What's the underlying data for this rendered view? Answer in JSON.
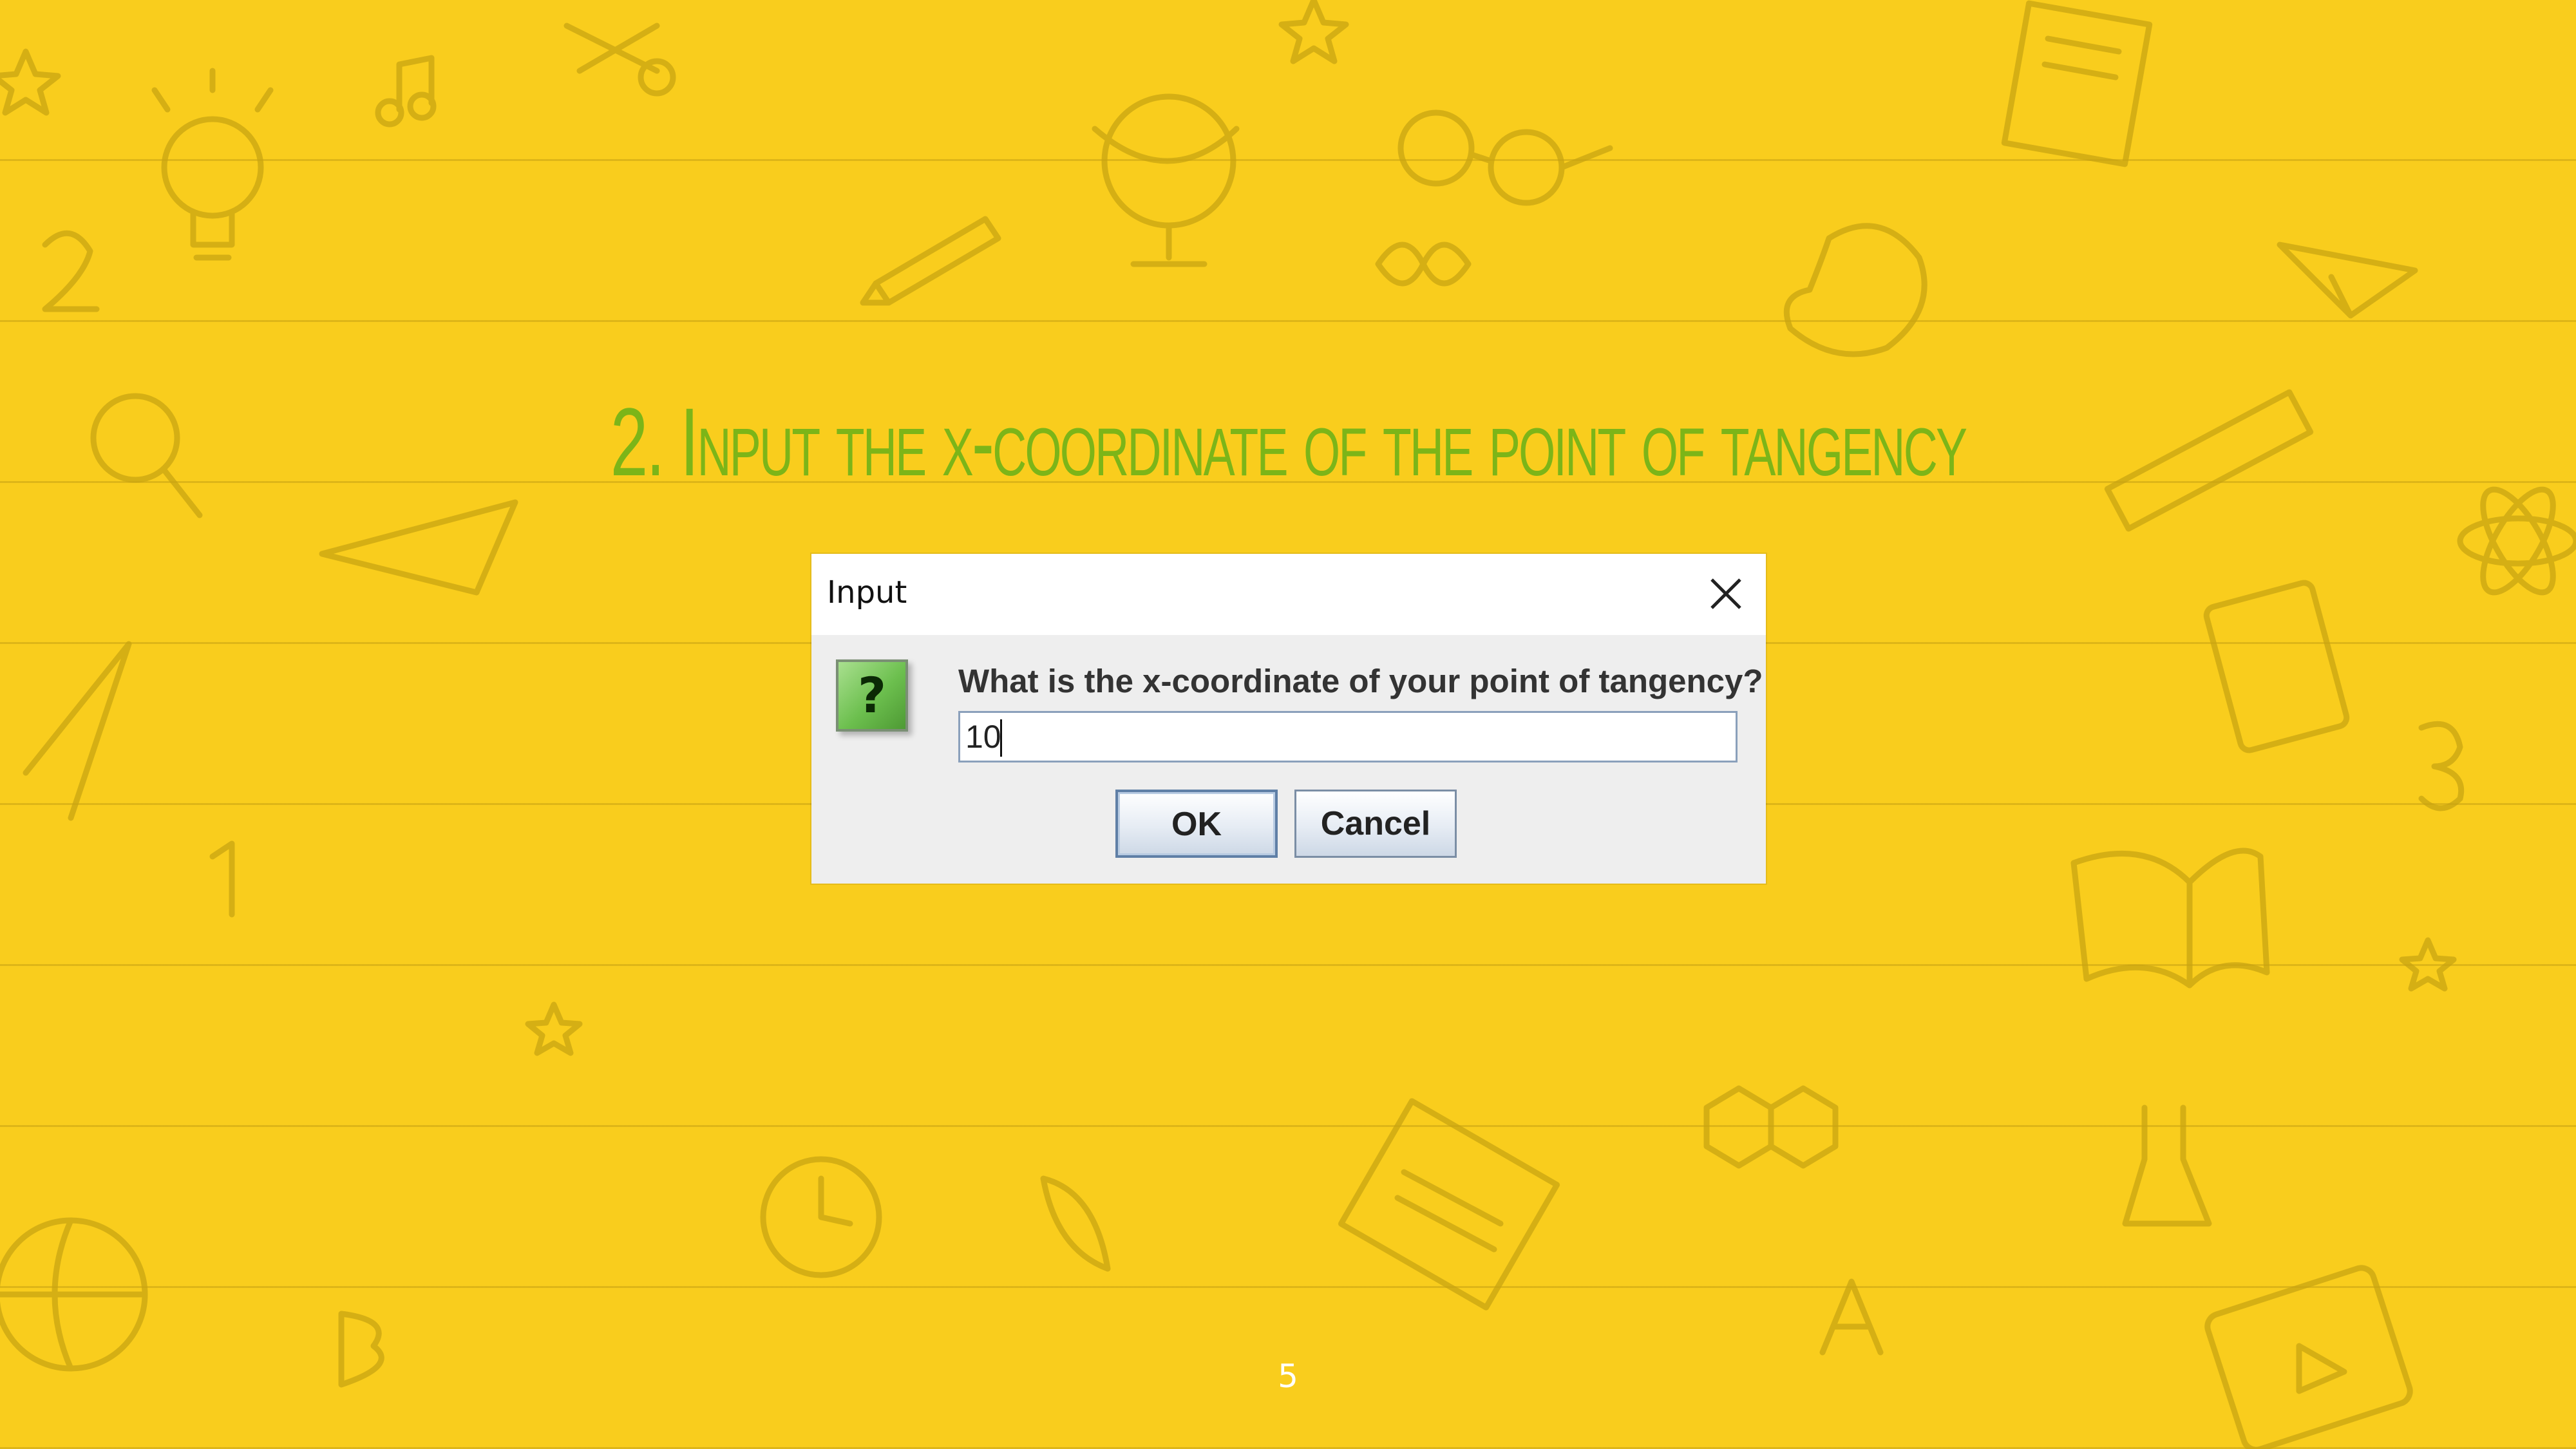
{
  "slide": {
    "title": "2. Input the x-coordinate of the point of tangency",
    "page_number": "5",
    "background_color": "#f9cd1d",
    "title_color": "#7cb518"
  },
  "dialog": {
    "title": "Input",
    "close_icon": "close-icon",
    "question_icon": "question-mark-icon",
    "question_glyph": "?",
    "prompt": "What is the x-coordinate of your point of tangency?",
    "input_value": "10",
    "ok_label": "OK",
    "cancel_label": "Cancel"
  }
}
